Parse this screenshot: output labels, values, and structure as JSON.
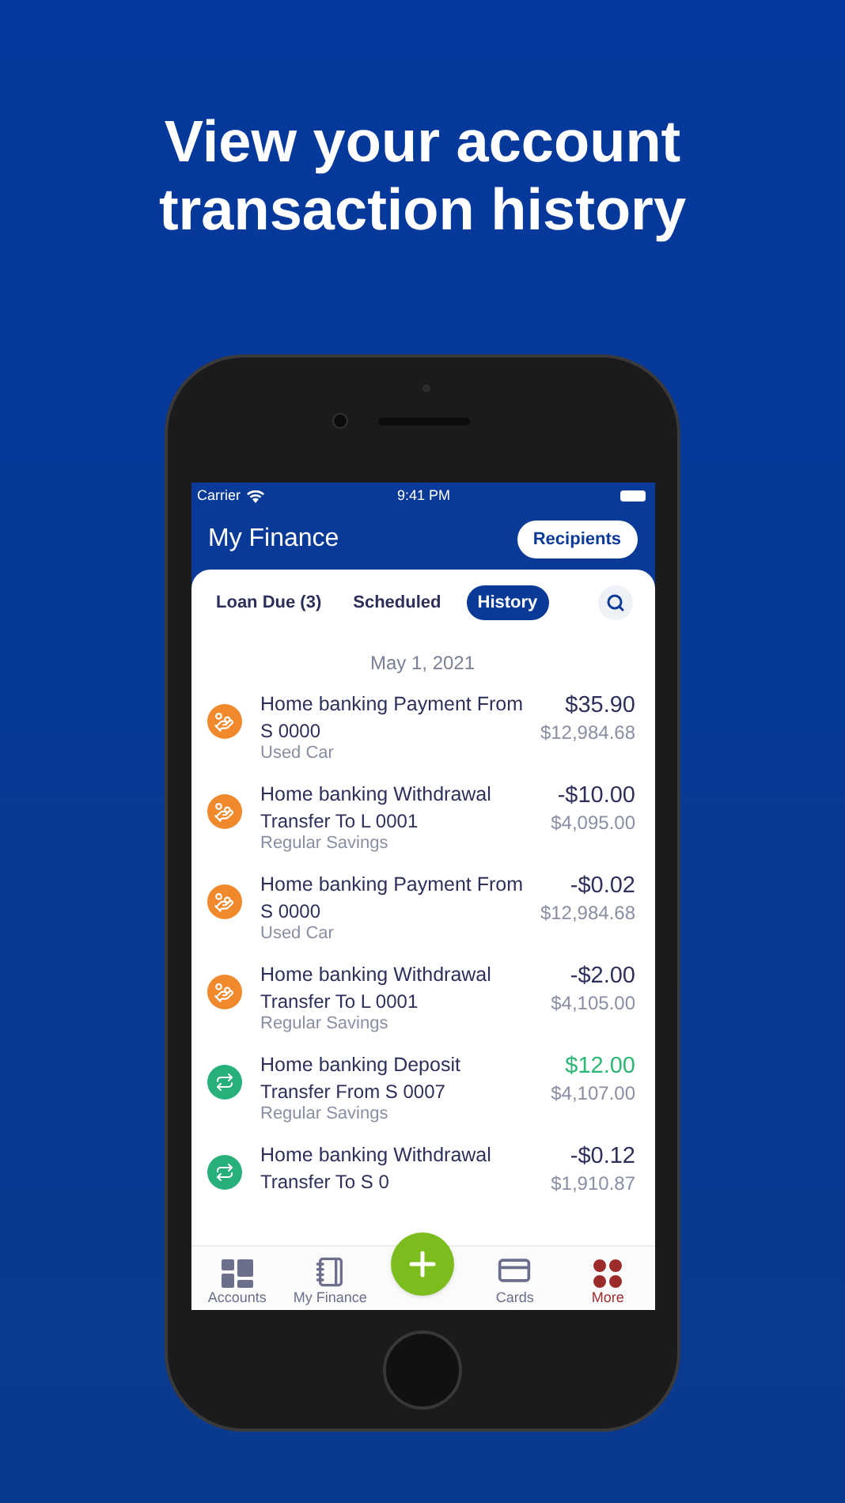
{
  "headline": "View your account transaction history",
  "status_bar": {
    "carrier": "Carrier",
    "time": "9:41 PM"
  },
  "header": {
    "title": "My Finance",
    "button": "Recipients"
  },
  "tabs": [
    {
      "label": "Loan Due (3)",
      "selected": false
    },
    {
      "label": "Scheduled",
      "selected": false
    },
    {
      "label": "History",
      "selected": true
    }
  ],
  "date": "May 1, 2021",
  "transactions": [
    {
      "kind": "payment",
      "title": "Home banking Payment From",
      "detail": "S 0000",
      "account": "Used Car",
      "amount": "$35.90",
      "color": "#2d2f5a",
      "balance": "$12,984.68"
    },
    {
      "kind": "payment",
      "title": "Home banking Withdrawal",
      "detail": "Transfer To L 0001",
      "account": "Regular Savings",
      "amount": "-$10.00",
      "color": "#2d2f5a",
      "balance": "$4,095.00"
    },
    {
      "kind": "payment",
      "title": "Home banking Payment From",
      "detail": "S 0000",
      "account": "Used Car",
      "amount": "-$0.02",
      "color": "#2d2f5a",
      "balance": "$12,984.68"
    },
    {
      "kind": "payment",
      "title": "Home banking Withdrawal",
      "detail": "Transfer To L 0001",
      "account": "Regular Savings",
      "amount": "-$2.00",
      "color": "#2d2f5a",
      "balance": "$4,105.00"
    },
    {
      "kind": "transfer",
      "title": "Home banking Deposit",
      "detail": "Transfer From S 0007",
      "account": "Regular Savings",
      "amount": "$12.00",
      "color": "#2bb673",
      "balance": "$4,107.00"
    },
    {
      "kind": "transfer",
      "title": "Home banking Withdrawal",
      "detail": "Transfer To S 0",
      "amount": "-$0.12",
      "color": "#2d2f5a",
      "balance": "$1,910.87"
    }
  ],
  "nav": [
    {
      "kind": "accounts",
      "label": "Accounts",
      "selected": false
    },
    {
      "kind": "finance",
      "label": "My Finance",
      "selected": false
    },
    {
      "kind": "add"
    },
    {
      "kind": "cards",
      "label": "Cards",
      "selected": false
    },
    {
      "kind": "more",
      "label": "More",
      "selected": true
    }
  ]
}
